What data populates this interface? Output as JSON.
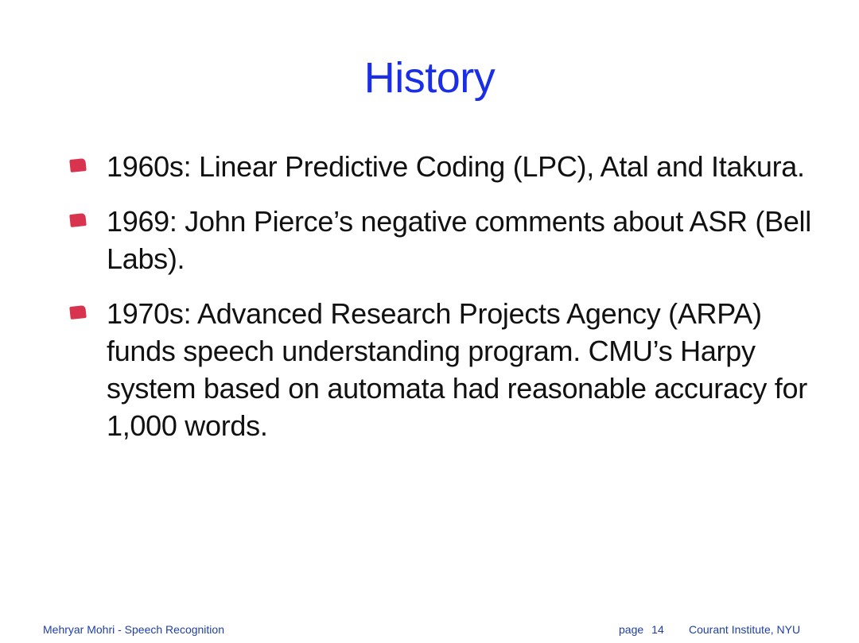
{
  "slide": {
    "title": "History",
    "bullets": [
      "1960s: Linear Predictive Coding (LPC), Atal and Itakura.",
      "1969: John Pierce’s negative comments about ASR (Bell Labs).",
      "1970s: Advanced Research Projects Agency (ARPA) funds speech understanding program. CMU’s Harpy system based on automata had reasonable accuracy for 1,000 words."
    ],
    "bullet_color": "#d8334f",
    "title_color": "#1a2ee8"
  },
  "footer": {
    "left": "Mehryar Mohri - Speech Recognition",
    "page_label": "page",
    "page_number": "14",
    "right": "Courant Institute, NYU"
  }
}
